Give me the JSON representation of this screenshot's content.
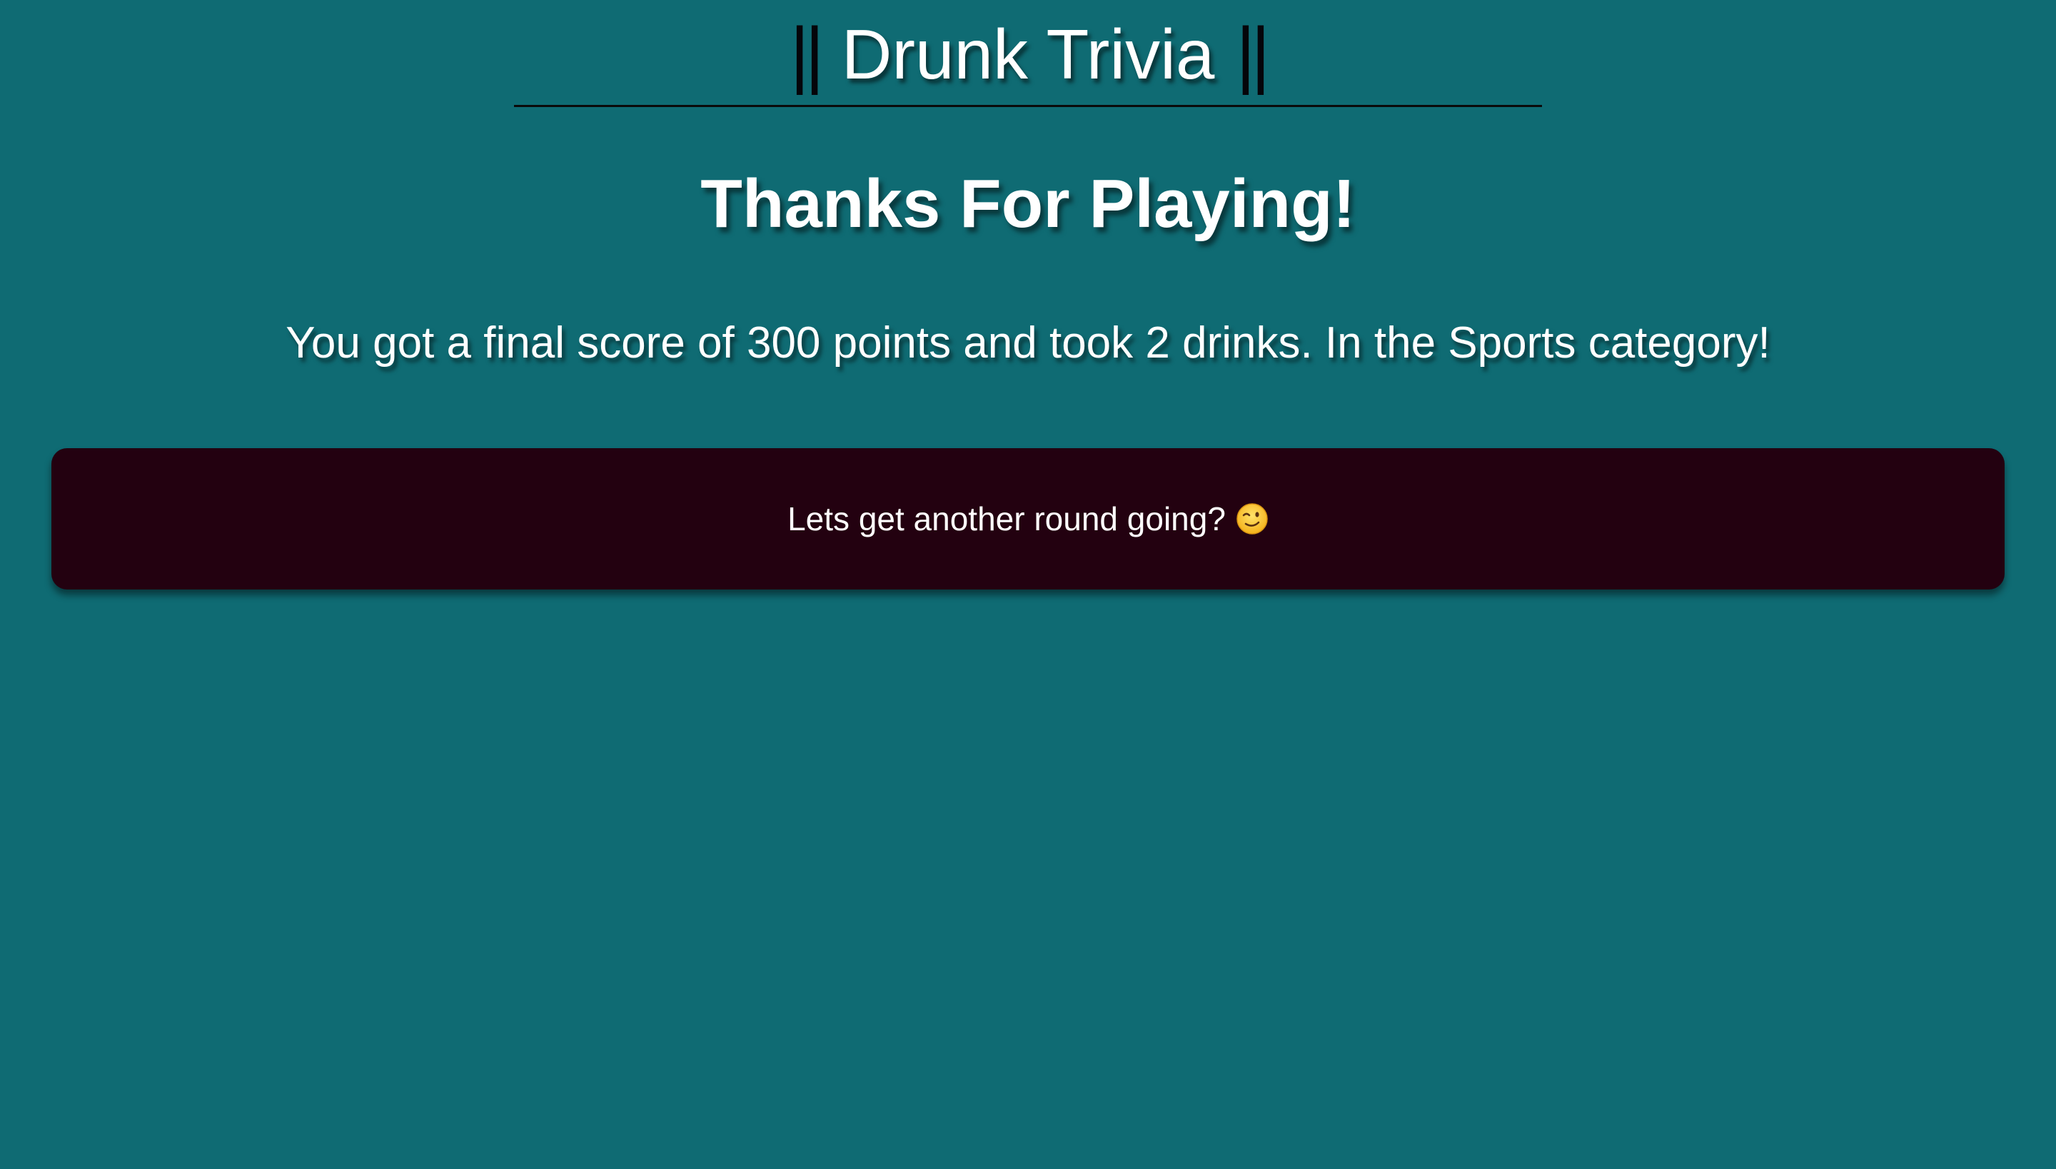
{
  "header": {
    "left_bars": "||",
    "title": "Drunk Trivia",
    "right_bars": "||"
  },
  "main": {
    "heading": "Thanks For Playing!",
    "score_text": "You got a final score of 300 points and took 2 drinks. In the Sports category!",
    "play_again_label": "Lets get another round going?",
    "play_again_icon": "winking-face-icon"
  },
  "colors": {
    "background": "#0f6b73",
    "button_background": "#230110",
    "text": "#ffffff"
  }
}
